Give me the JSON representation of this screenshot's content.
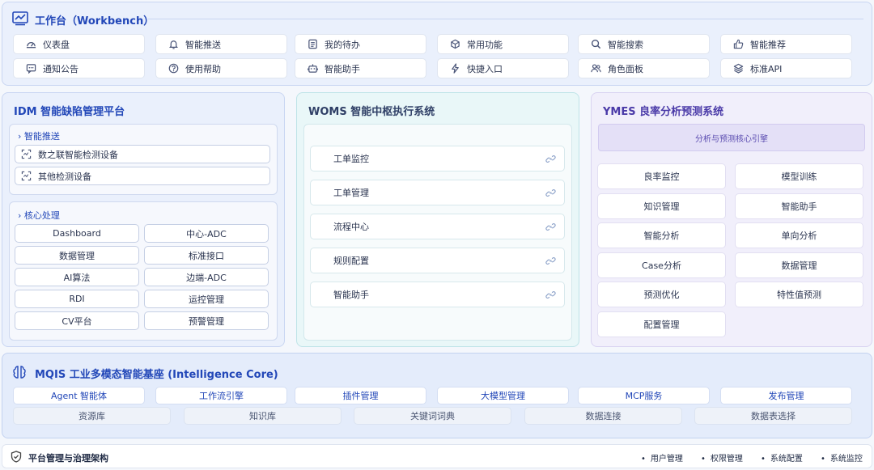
{
  "workbench": {
    "title": "工作台（Workbench）",
    "items": [
      {
        "label": "仪表盘",
        "icon": "gauge-icon"
      },
      {
        "label": "智能推送",
        "icon": "bell-icon"
      },
      {
        "label": "我的待办",
        "icon": "todo-list-icon"
      },
      {
        "label": "常用功能",
        "icon": "cube-icon"
      },
      {
        "label": "智能搜索",
        "icon": "search-icon"
      },
      {
        "label": "智能推荐",
        "icon": "thumbs-up-icon"
      },
      {
        "label": "通知公告",
        "icon": "message-icon"
      },
      {
        "label": "使用帮助",
        "icon": "help-icon"
      },
      {
        "label": "智能助手",
        "icon": "robot-icon"
      },
      {
        "label": "快捷入口",
        "icon": "lightning-icon"
      },
      {
        "label": "角色面板",
        "icon": "users-icon"
      },
      {
        "label": "标准API",
        "icon": "layers-icon"
      }
    ]
  },
  "idm": {
    "title": "IDM  智能缺陷管理平台",
    "push_header": "智能推送",
    "devices": [
      "数之联智能检测设备",
      "其他检测设备"
    ],
    "core_header": "核心处理",
    "core_items": [
      "Dashboard",
      "中心-ADC",
      "数据管理",
      "标准接口",
      "AI算法",
      "边端-ADC",
      "RDI",
      "运控管理",
      "CV平台",
      "预警管理"
    ]
  },
  "woms": {
    "title": "WOMS  智能中枢执行系统",
    "items": [
      "工单监控",
      "工单管理",
      "流程中心",
      "规则配置",
      "智能助手"
    ]
  },
  "ymes": {
    "title": "YMES  良率分析预测系统",
    "engine": "分析与预测核心引擎",
    "items": [
      "良率监控",
      "模型训练",
      "知识管理",
      "智能助手",
      "智能分析",
      "单向分析",
      "Case分析",
      "数据管理",
      "预测优化",
      "特性值预测",
      "配置管理"
    ]
  },
  "mqis": {
    "title": "MQIS  工业多模态智能基座   (Intelligence Core)",
    "row1": [
      "Agent 智能体",
      "工作流引擎",
      "插件管理",
      "大模型管理",
      "MCP服务",
      "发布管理"
    ],
    "row2": [
      "资源库",
      "知识库",
      "关键词词典",
      "数据连接",
      "数据表选择"
    ]
  },
  "footer": {
    "title": "平台管理与治理架构",
    "items": [
      "用户管理",
      "权限管理",
      "系统配置",
      "系统监控"
    ]
  }
}
